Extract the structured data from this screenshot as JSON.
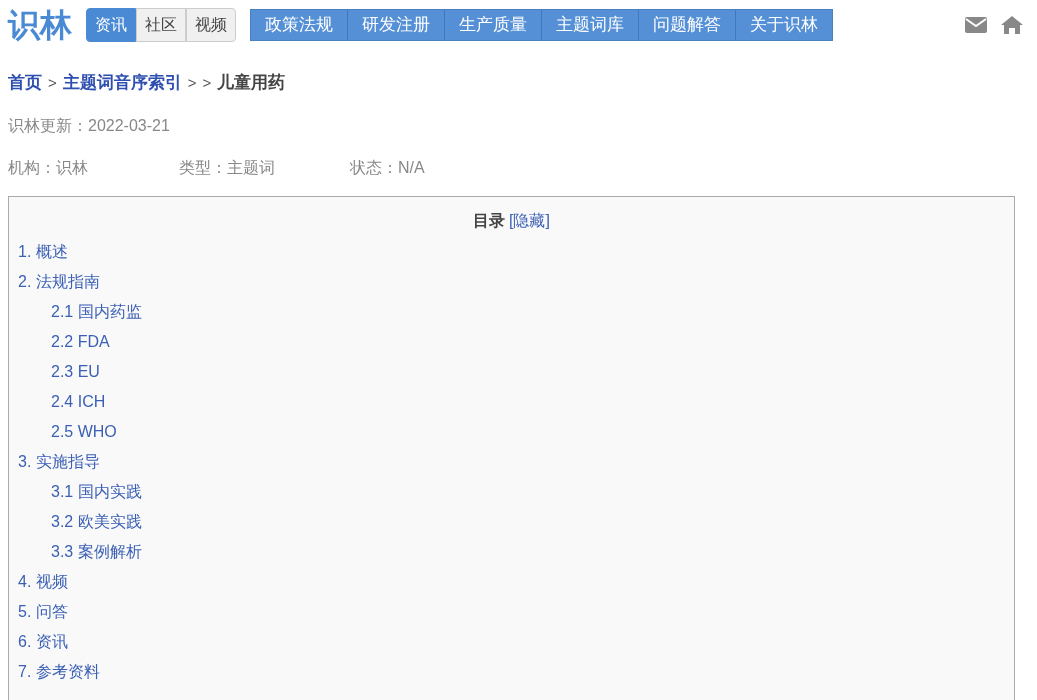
{
  "logo": "识林",
  "section_tabs": [
    {
      "label": "资讯",
      "selected": true
    },
    {
      "label": "社区",
      "selected": false
    },
    {
      "label": "视频",
      "selected": false
    }
  ],
  "nav": [
    "政策法规",
    "研发注册",
    "生产质量",
    "主题词库",
    "问题解答",
    "关于识林"
  ],
  "breadcrumb": [
    {
      "label": "首页",
      "kind": "link"
    },
    {
      "label": ">",
      "kind": "sep"
    },
    {
      "label": "主题词音序索引",
      "kind": "link"
    },
    {
      "label": ">",
      "kind": "sep"
    },
    {
      "label": ">",
      "kind": "sep"
    },
    {
      "label": "儿童用药",
      "kind": "current"
    }
  ],
  "updated": "识林更新：2022-03-21",
  "meta": [
    "机构：识林",
    "类型：主题词",
    "状态：N/A"
  ],
  "toc": {
    "title": "目录",
    "toggle": "[隐藏]",
    "items": [
      {
        "label": "1. 概述"
      },
      {
        "label": "2. 法规指南",
        "children": [
          {
            "label": "2.1 国内药监"
          },
          {
            "label": "2.2 FDA"
          },
          {
            "label": "2.3 EU"
          },
          {
            "label": "2.4 ICH"
          },
          {
            "label": "2.5 WHO"
          }
        ]
      },
      {
        "label": "3. 实施指导",
        "children": [
          {
            "label": "3.1 国内实践"
          },
          {
            "label": "3.2 欧美实践"
          },
          {
            "label": "3.3 案例解析"
          }
        ]
      },
      {
        "label": "4. 视频"
      },
      {
        "label": "5. 问答"
      },
      {
        "label": "6. 资讯"
      },
      {
        "label": "7. 参考资料"
      }
    ]
  }
}
